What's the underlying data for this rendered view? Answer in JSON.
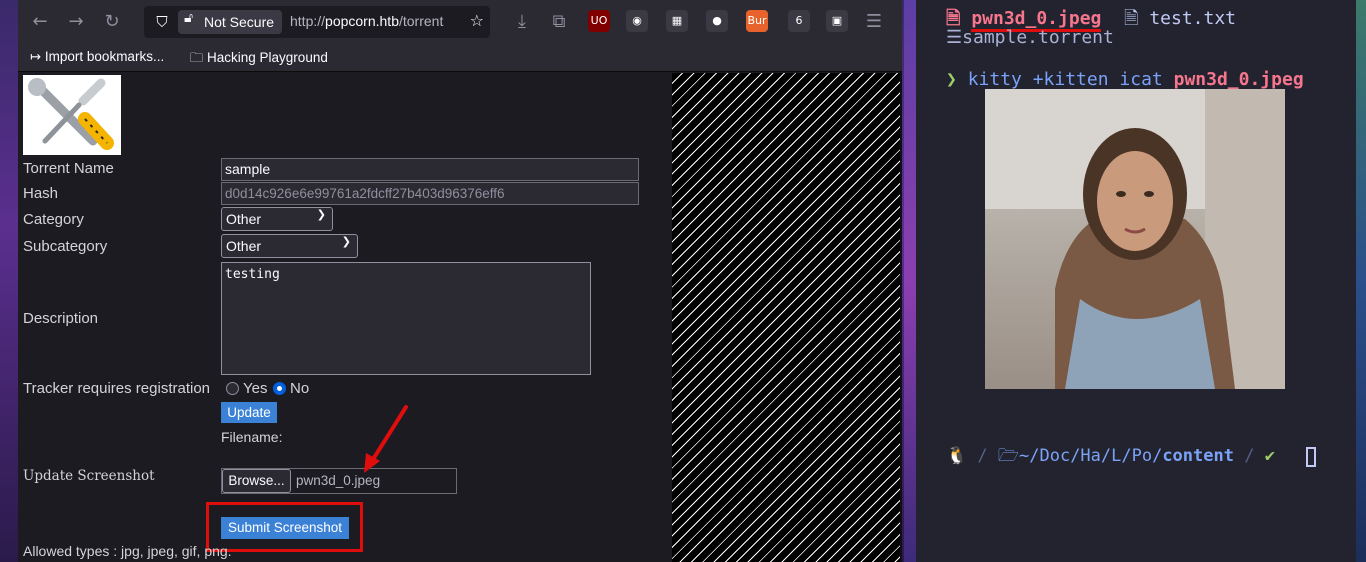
{
  "browser": {
    "url_status": "Not Secure",
    "url_scheme": "http://",
    "url_host": "popcorn.htb",
    "url_rest": "/torrent",
    "extensions": [
      {
        "name": "ublock-origin-icon",
        "label": "UO",
        "color": "#800000"
      },
      {
        "name": "privacy-badger-icon",
        "label": "◉",
        "color": "#3a3944"
      },
      {
        "name": "qr-code-icon",
        "label": "▦",
        "color": "#3a3944"
      },
      {
        "name": "cookie-icon",
        "label": "●",
        "color": "#3a3944"
      },
      {
        "name": "burp-proxy-icon",
        "label": "Bur",
        "color": "#e8632b"
      },
      {
        "name": "container-badge-icon",
        "label": "6",
        "color": "#3a3944"
      },
      {
        "name": "screenshot-icon",
        "label": "▣",
        "color": "#3a3944"
      }
    ],
    "bookmarks": [
      {
        "label": "Import bookmarks...",
        "icon": "↦"
      },
      {
        "label": "Hacking Playground",
        "icon": "🗀"
      }
    ]
  },
  "form": {
    "torrent_name_label": "Torrent Name",
    "torrent_name_value": "sample",
    "hash_label": "Hash",
    "hash_value": "d0d14c926e6e99761a2fdcff27b403d96376eff6",
    "category_label": "Category",
    "category_value": "Other",
    "subcategory_label": "Subcategory",
    "subcategory_value": "Other",
    "description_label": "Description",
    "description_value": "testing",
    "tracker_label": "Tracker requires registration",
    "tracker_yes": "Yes",
    "tracker_no": "No",
    "tracker_selected": "No",
    "update_button": "Update",
    "filename_label": "Filename:",
    "update_screenshot_label": "Update Screenshot",
    "browse_button": "Browse...",
    "selected_file": "pwn3d_0.jpeg",
    "submit_button": "Submit Screenshot",
    "allowed_types": "Allowed types : jpg, jpeg, gif, png."
  },
  "terminal": {
    "files": [
      {
        "name": "pwn3d_0.jpeg",
        "icon": "🗎",
        "color": "#f7768e"
      },
      {
        "name": "test.txt",
        "icon": "🗎",
        "color": "#c0caf5"
      },
      {
        "name": "sample.torrent",
        "icon": "☰",
        "color": "#a9b1d6"
      }
    ],
    "command_prompt": "❯",
    "command": "kitty +kitten icat",
    "command_arg": "pwn3d_0.jpeg",
    "prompt_os_icon": "🐧",
    "prompt_folder_icon": "🗁",
    "prompt_path": "~/Doc/Ha/L/Po/",
    "prompt_dir": "content",
    "prompt_status": "✔",
    "colors": {
      "accent": "#7aa2f7",
      "green": "#9ece6a",
      "red": "#f7768e",
      "text": "#c0caf5"
    }
  }
}
